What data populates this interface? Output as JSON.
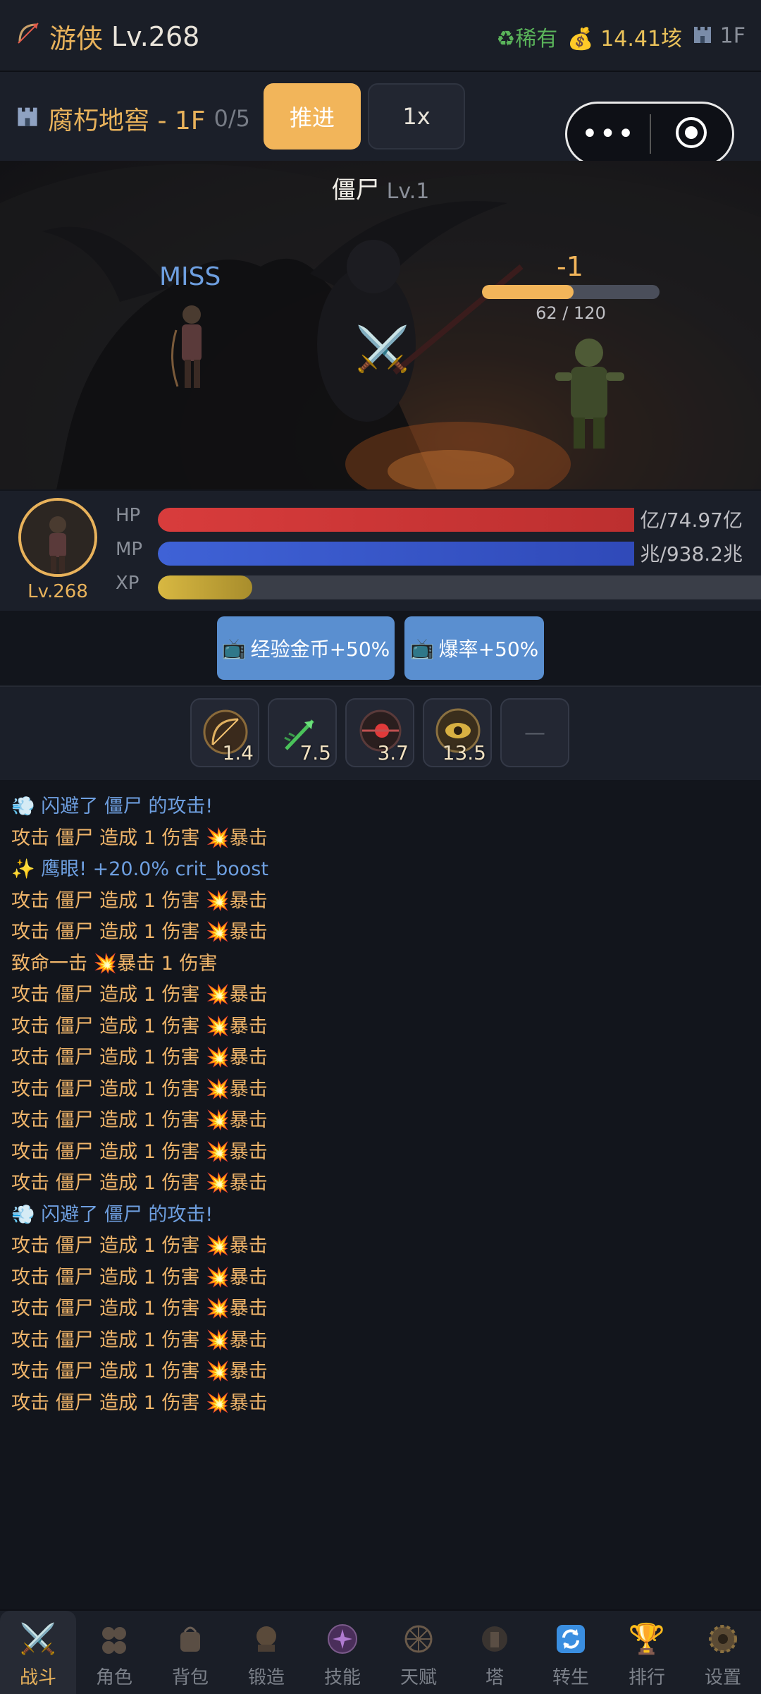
{
  "header": {
    "class_icon": "bow-icon",
    "class_name": "游侠",
    "level": "Lv.268",
    "rarity_icon": "recycle-icon",
    "rarity": "稀有",
    "gold_icon": "money-bag-icon",
    "gold": "14.41垓",
    "floor_icon": "castle-icon",
    "floor": "1F"
  },
  "floorbar": {
    "dungeon_icon": "castle-icon",
    "dungeon": "腐朽地窖 - 1F",
    "progress": "0/5",
    "advance_label": "推进",
    "speed_label": "1x",
    "more_label": "•••"
  },
  "battle": {
    "enemy_name": "僵尸",
    "enemy_level": "Lv.1",
    "miss_text": "MISS",
    "damage_text": "-1",
    "enemy_hp_text": "62 / 120",
    "enemy_hp_fraction": 0.517,
    "clash_icon": "crossed-swords-icon"
  },
  "player": {
    "level": "Lv.268",
    "hp_label": "HP",
    "hp_text": "亿/74.97亿",
    "hp_fraction": 1.0,
    "mp_label": "MP",
    "mp_text": "兆/938.2兆",
    "mp_fraction": 1.0,
    "xp_label": "XP",
    "xp_fraction": 0.15
  },
  "buffs": [
    {
      "icon": "tv-icon",
      "label": "经验金币+50%"
    },
    {
      "icon": "tv-icon",
      "label": "爆率+50%"
    }
  ],
  "skills": [
    {
      "icon": "bow-target-skill-icon",
      "cooldown": "1.4"
    },
    {
      "icon": "green-arrow-skill-icon",
      "cooldown": "7.5"
    },
    {
      "icon": "red-orb-skill-icon",
      "cooldown": "3.7"
    },
    {
      "icon": "hawk-eye-skill-icon",
      "cooldown": "13.5"
    },
    {
      "icon": "empty-slot",
      "cooldown": "—"
    }
  ],
  "log": [
    {
      "type": "info",
      "text": "💨 闪避了 僵尸 的攻击!"
    },
    {
      "type": "attack",
      "text": "攻击 僵尸 造成 1 伤害 💥暴击"
    },
    {
      "type": "info",
      "text": "✨ 鹰眼! +20.0% crit_boost"
    },
    {
      "type": "attack",
      "text": "攻击 僵尸 造成 1 伤害 💥暴击"
    },
    {
      "type": "attack",
      "text": "攻击 僵尸 造成 1 伤害 💥暴击"
    },
    {
      "type": "attack",
      "text": "致命一击 💥暴击 1 伤害"
    },
    {
      "type": "attack",
      "text": "攻击 僵尸 造成 1 伤害 💥暴击"
    },
    {
      "type": "attack",
      "text": "攻击 僵尸 造成 1 伤害 💥暴击"
    },
    {
      "type": "attack",
      "text": "攻击 僵尸 造成 1 伤害 💥暴击"
    },
    {
      "type": "attack",
      "text": "攻击 僵尸 造成 1 伤害 💥暴击"
    },
    {
      "type": "attack",
      "text": "攻击 僵尸 造成 1 伤害 💥暴击"
    },
    {
      "type": "attack",
      "text": "攻击 僵尸 造成 1 伤害 💥暴击"
    },
    {
      "type": "attack",
      "text": "攻击 僵尸 造成 1 伤害 💥暴击"
    },
    {
      "type": "info",
      "text": "💨 闪避了 僵尸 的攻击!"
    },
    {
      "type": "attack",
      "text": "攻击 僵尸 造成 1 伤害 💥暴击"
    },
    {
      "type": "attack",
      "text": "攻击 僵尸 造成 1 伤害 💥暴击"
    },
    {
      "type": "attack",
      "text": "攻击 僵尸 造成 1 伤害 💥暴击"
    },
    {
      "type": "attack",
      "text": "攻击 僵尸 造成 1 伤害 💥暴击"
    },
    {
      "type": "attack",
      "text": "攻击 僵尸 造成 1 伤害 💥暴击"
    },
    {
      "type": "attack",
      "text": "攻击 僵尸 造成 1 伤害 💥暴击"
    }
  ],
  "nav": [
    {
      "icon": "crossed-swords-icon",
      "label": "战斗",
      "active": true
    },
    {
      "icon": "character-icon",
      "label": "角色",
      "active": false
    },
    {
      "icon": "bag-icon",
      "label": "背包",
      "active": false
    },
    {
      "icon": "anvil-icon",
      "label": "锻造",
      "active": false
    },
    {
      "icon": "skill-icon",
      "label": "技能",
      "active": false
    },
    {
      "icon": "talent-icon",
      "label": "天赋",
      "active": false
    },
    {
      "icon": "tower-icon",
      "label": "塔",
      "active": false
    },
    {
      "icon": "rebirth-icon",
      "label": "转生",
      "active": false
    },
    {
      "icon": "trophy-icon",
      "label": "排行",
      "active": false
    },
    {
      "icon": "gear-icon",
      "label": "设置",
      "active": false
    }
  ],
  "colors": {
    "accent": "#e8b25b",
    "background": "#12151c",
    "panel": "#1b1f29",
    "hp": "#d83c3c",
    "mp": "#3f62d6",
    "xp": "#d8b842",
    "info_text": "#6e9fe0",
    "log_text": "#f0b56a"
  }
}
